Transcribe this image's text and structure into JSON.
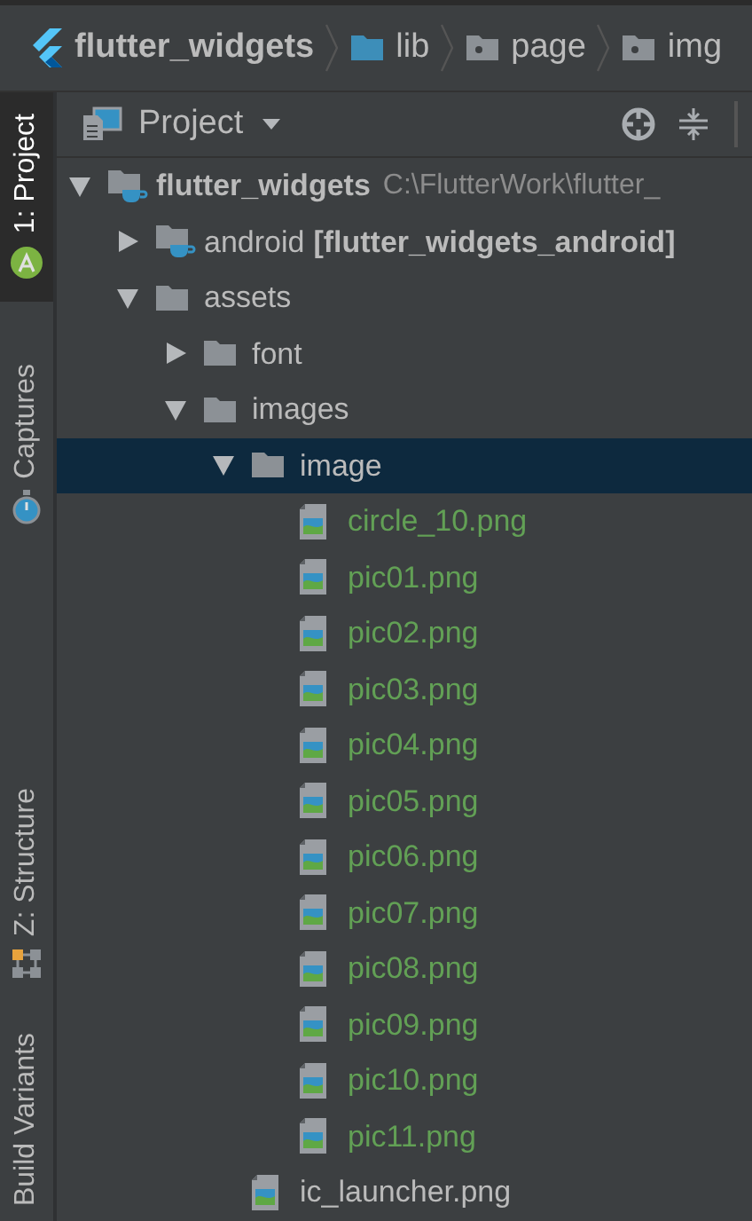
{
  "breadcrumbs": [
    {
      "label": "flutter_widgets",
      "kind": "project"
    },
    {
      "label": "lib",
      "kind": "source"
    },
    {
      "label": "page",
      "kind": "package"
    },
    {
      "label": "img",
      "kind": "package"
    }
  ],
  "side_tabs": [
    {
      "label": "1: Project",
      "selected": true,
      "kind": "android"
    },
    {
      "label": "Captures",
      "selected": false,
      "kind": "captures"
    },
    {
      "label": "Z: Structure",
      "selected": false,
      "kind": "structure"
    },
    {
      "label": "Build Variants",
      "selected": false,
      "kind": "none"
    }
  ],
  "panel": {
    "title": "Project"
  },
  "tree": [
    {
      "label": "flutter_widgets",
      "kind": "project",
      "path": "C:\\FlutterWork\\flutter_",
      "expanded": true,
      "selected": false,
      "children": [
        {
          "label": "android",
          "module": "[flutter_widgets_android]",
          "kind": "module",
          "expanded": false,
          "selected": false
        },
        {
          "label": "assets",
          "kind": "folder",
          "expanded": true,
          "selected": false,
          "children": [
            {
              "label": "font",
              "kind": "folder",
              "expanded": false,
              "selected": false
            },
            {
              "label": "images",
              "kind": "folder",
              "expanded": true,
              "selected": false,
              "children": [
                {
                  "label": "image",
                  "kind": "folder",
                  "expanded": true,
                  "selected": true,
                  "children": [
                    {
                      "label": "circle_10.png",
                      "kind": "image",
                      "color": "#62a055",
                      "selected": false
                    },
                    {
                      "label": "pic01.png",
                      "kind": "image",
                      "color": "#62a055",
                      "selected": false
                    },
                    {
                      "label": "pic02.png",
                      "kind": "image",
                      "color": "#62a055",
                      "selected": false
                    },
                    {
                      "label": "pic03.png",
                      "kind": "image",
                      "color": "#62a055",
                      "selected": false
                    },
                    {
                      "label": "pic04.png",
                      "kind": "image",
                      "color": "#62a055",
                      "selected": false
                    },
                    {
                      "label": "pic05.png",
                      "kind": "image",
                      "color": "#62a055",
                      "selected": false
                    },
                    {
                      "label": "pic06.png",
                      "kind": "image",
                      "color": "#62a055",
                      "selected": false
                    },
                    {
                      "label": "pic07.png",
                      "kind": "image",
                      "color": "#62a055",
                      "selected": false
                    },
                    {
                      "label": "pic08.png",
                      "kind": "image",
                      "color": "#62a055",
                      "selected": false
                    },
                    {
                      "label": "pic09.png",
                      "kind": "image",
                      "color": "#62a055",
                      "selected": false
                    },
                    {
                      "label": "pic10.png",
                      "kind": "image",
                      "color": "#62a055",
                      "selected": false
                    },
                    {
                      "label": "pic11.png",
                      "kind": "image",
                      "color": "#62a055",
                      "selected": false
                    }
                  ]
                },
                {
                  "label": "ic_launcher.png",
                  "kind": "image",
                  "color": "#bbbbbb",
                  "selected": false
                }
              ]
            }
          ]
        }
      ]
    }
  ]
}
